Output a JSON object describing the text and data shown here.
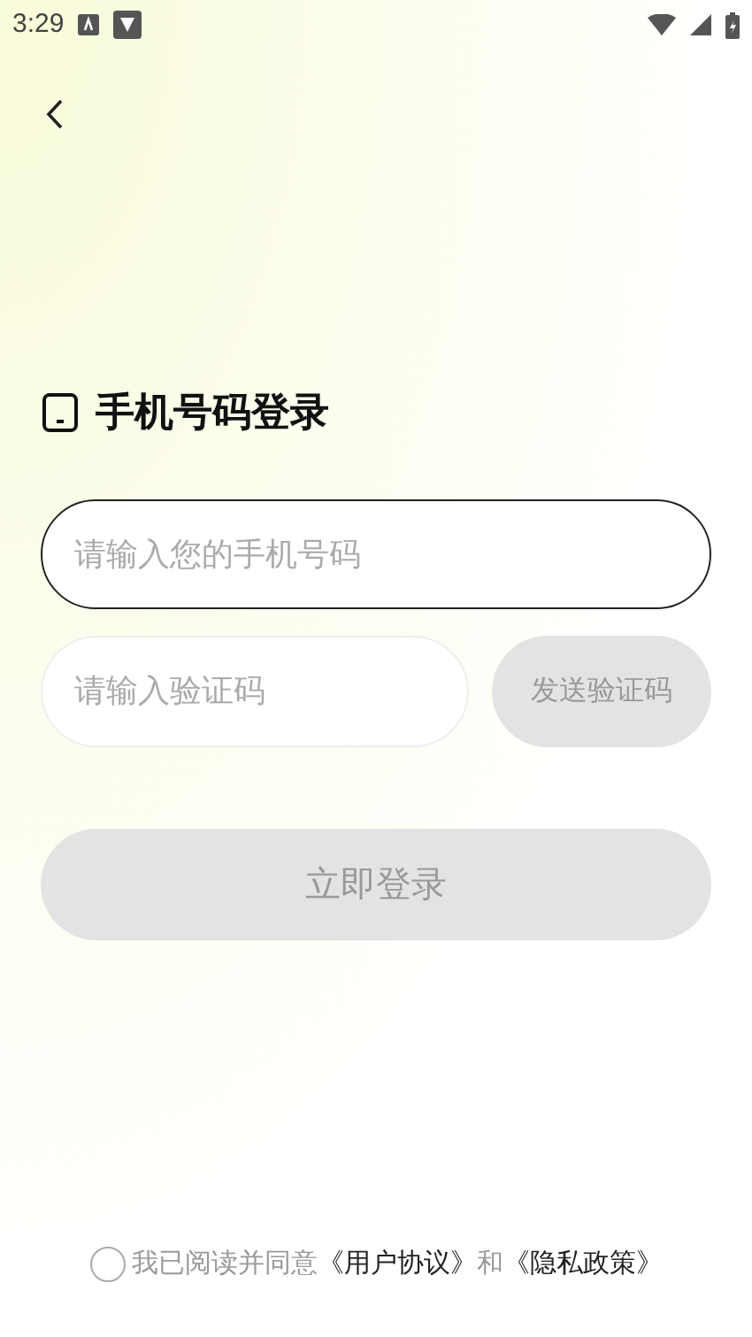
{
  "status_bar": {
    "time": "3:29"
  },
  "title": "手机号码登录",
  "phone_field": {
    "placeholder": "请输入您的手机号码",
    "focused": true
  },
  "code_field": {
    "placeholder": "请输入验证码",
    "focused": false
  },
  "send_code_button": {
    "label": "发送验证码",
    "disabled": true
  },
  "login_button": {
    "label": "立即登录",
    "disabled": true
  },
  "agreement": {
    "checked": false,
    "text": "我已阅读并同意",
    "link_1": "《用户协议》",
    "conjunction": "和",
    "link_2": "《隐私政策》"
  }
}
